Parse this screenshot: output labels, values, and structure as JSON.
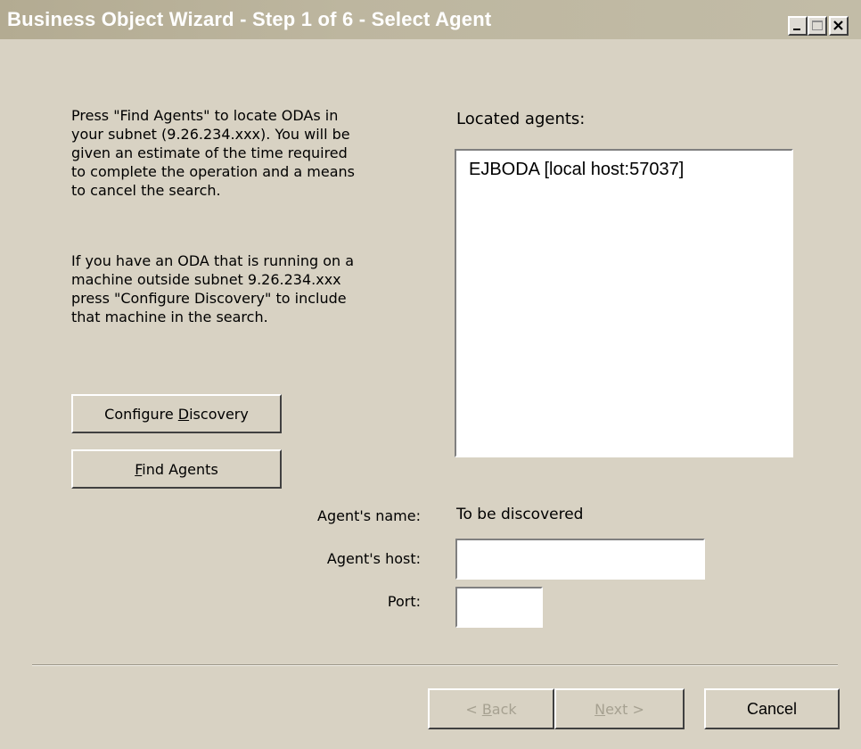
{
  "window": {
    "title": "Business Object Wizard - Step 1 of 6 - Select Agent",
    "controls": {
      "minimize": "minimize-icon",
      "maximize": "maximize-icon",
      "close": "close-icon"
    }
  },
  "instructions": {
    "find_text": "Press \"Find Agents\" to locate ODAs in your subnet (9.26.234.xxx). You will be given an estimate of the time required to complete the operation and a means to cancel the search.",
    "configure_text": "If you have an ODA that is running on a machine outside subnet 9.26.234.xxx press \"Configure Discovery\" to include that machine in the search."
  },
  "buttons": {
    "configure_pre": "Configure ",
    "configure_mnemonic": "D",
    "configure_post": "iscovery",
    "find_mnemonic": "F",
    "find_post": "ind Agents",
    "back_pre": "< ",
    "back_mnemonic": "B",
    "back_post": "ack",
    "next_mnemonic": "N",
    "next_post": "ext >",
    "cancel": "Cancel"
  },
  "agents": {
    "label": "Located agents:",
    "items": [
      "EJBODA [local host:57037]"
    ]
  },
  "fields": {
    "name_label": "Agent's name:",
    "name_value": "To be discovered",
    "host_label": "Agent's host:",
    "host_value": "",
    "port_label": "Port:",
    "port_value": ""
  }
}
